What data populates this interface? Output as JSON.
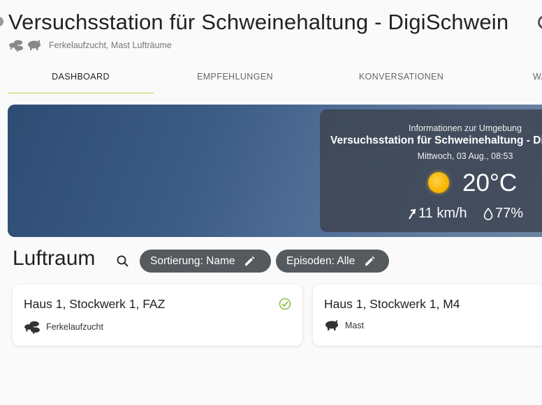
{
  "header": {
    "title": "Versuchsstation für Schweinehaltung - DigiSchwein",
    "subtitle": "Ferkelaufzucht, Mast Lufträume"
  },
  "tabs": [
    {
      "label": "DASHBOARD",
      "active": true
    },
    {
      "label": "EMPFEHLUNGEN",
      "active": false
    },
    {
      "label": "KONVERSATIONEN",
      "active": false
    },
    {
      "label": "WA",
      "active": false
    }
  ],
  "weather": {
    "heading": "Informationen zur Umgebung",
    "station": "Versuchsstation für Schweinehaltung - DigiSchwein",
    "date": "Mittwoch, 03 Aug., 08:53",
    "temperature": "20°C",
    "wind": "11 km/h",
    "humidity": "77%",
    "icon": "sun-icon"
  },
  "section": {
    "title": "Luftraum",
    "sort_chip": "Sortierung: Name",
    "episode_chip": "Episoden: Alle"
  },
  "cards": [
    {
      "title": "Haus 1, Stockwerk 1, FAZ",
      "type": "Ferkelaufzucht",
      "icon": "piglets-icon",
      "status": "check-circle-icon"
    },
    {
      "title": "Haus 1, Stockwerk 1, M4",
      "type": "Mast",
      "icon": "pig-icon"
    }
  ],
  "colors": {
    "accent": "#c9d44a",
    "chip": "#555a5f",
    "check": "#8bc34a",
    "banner": "#3c5c85"
  }
}
